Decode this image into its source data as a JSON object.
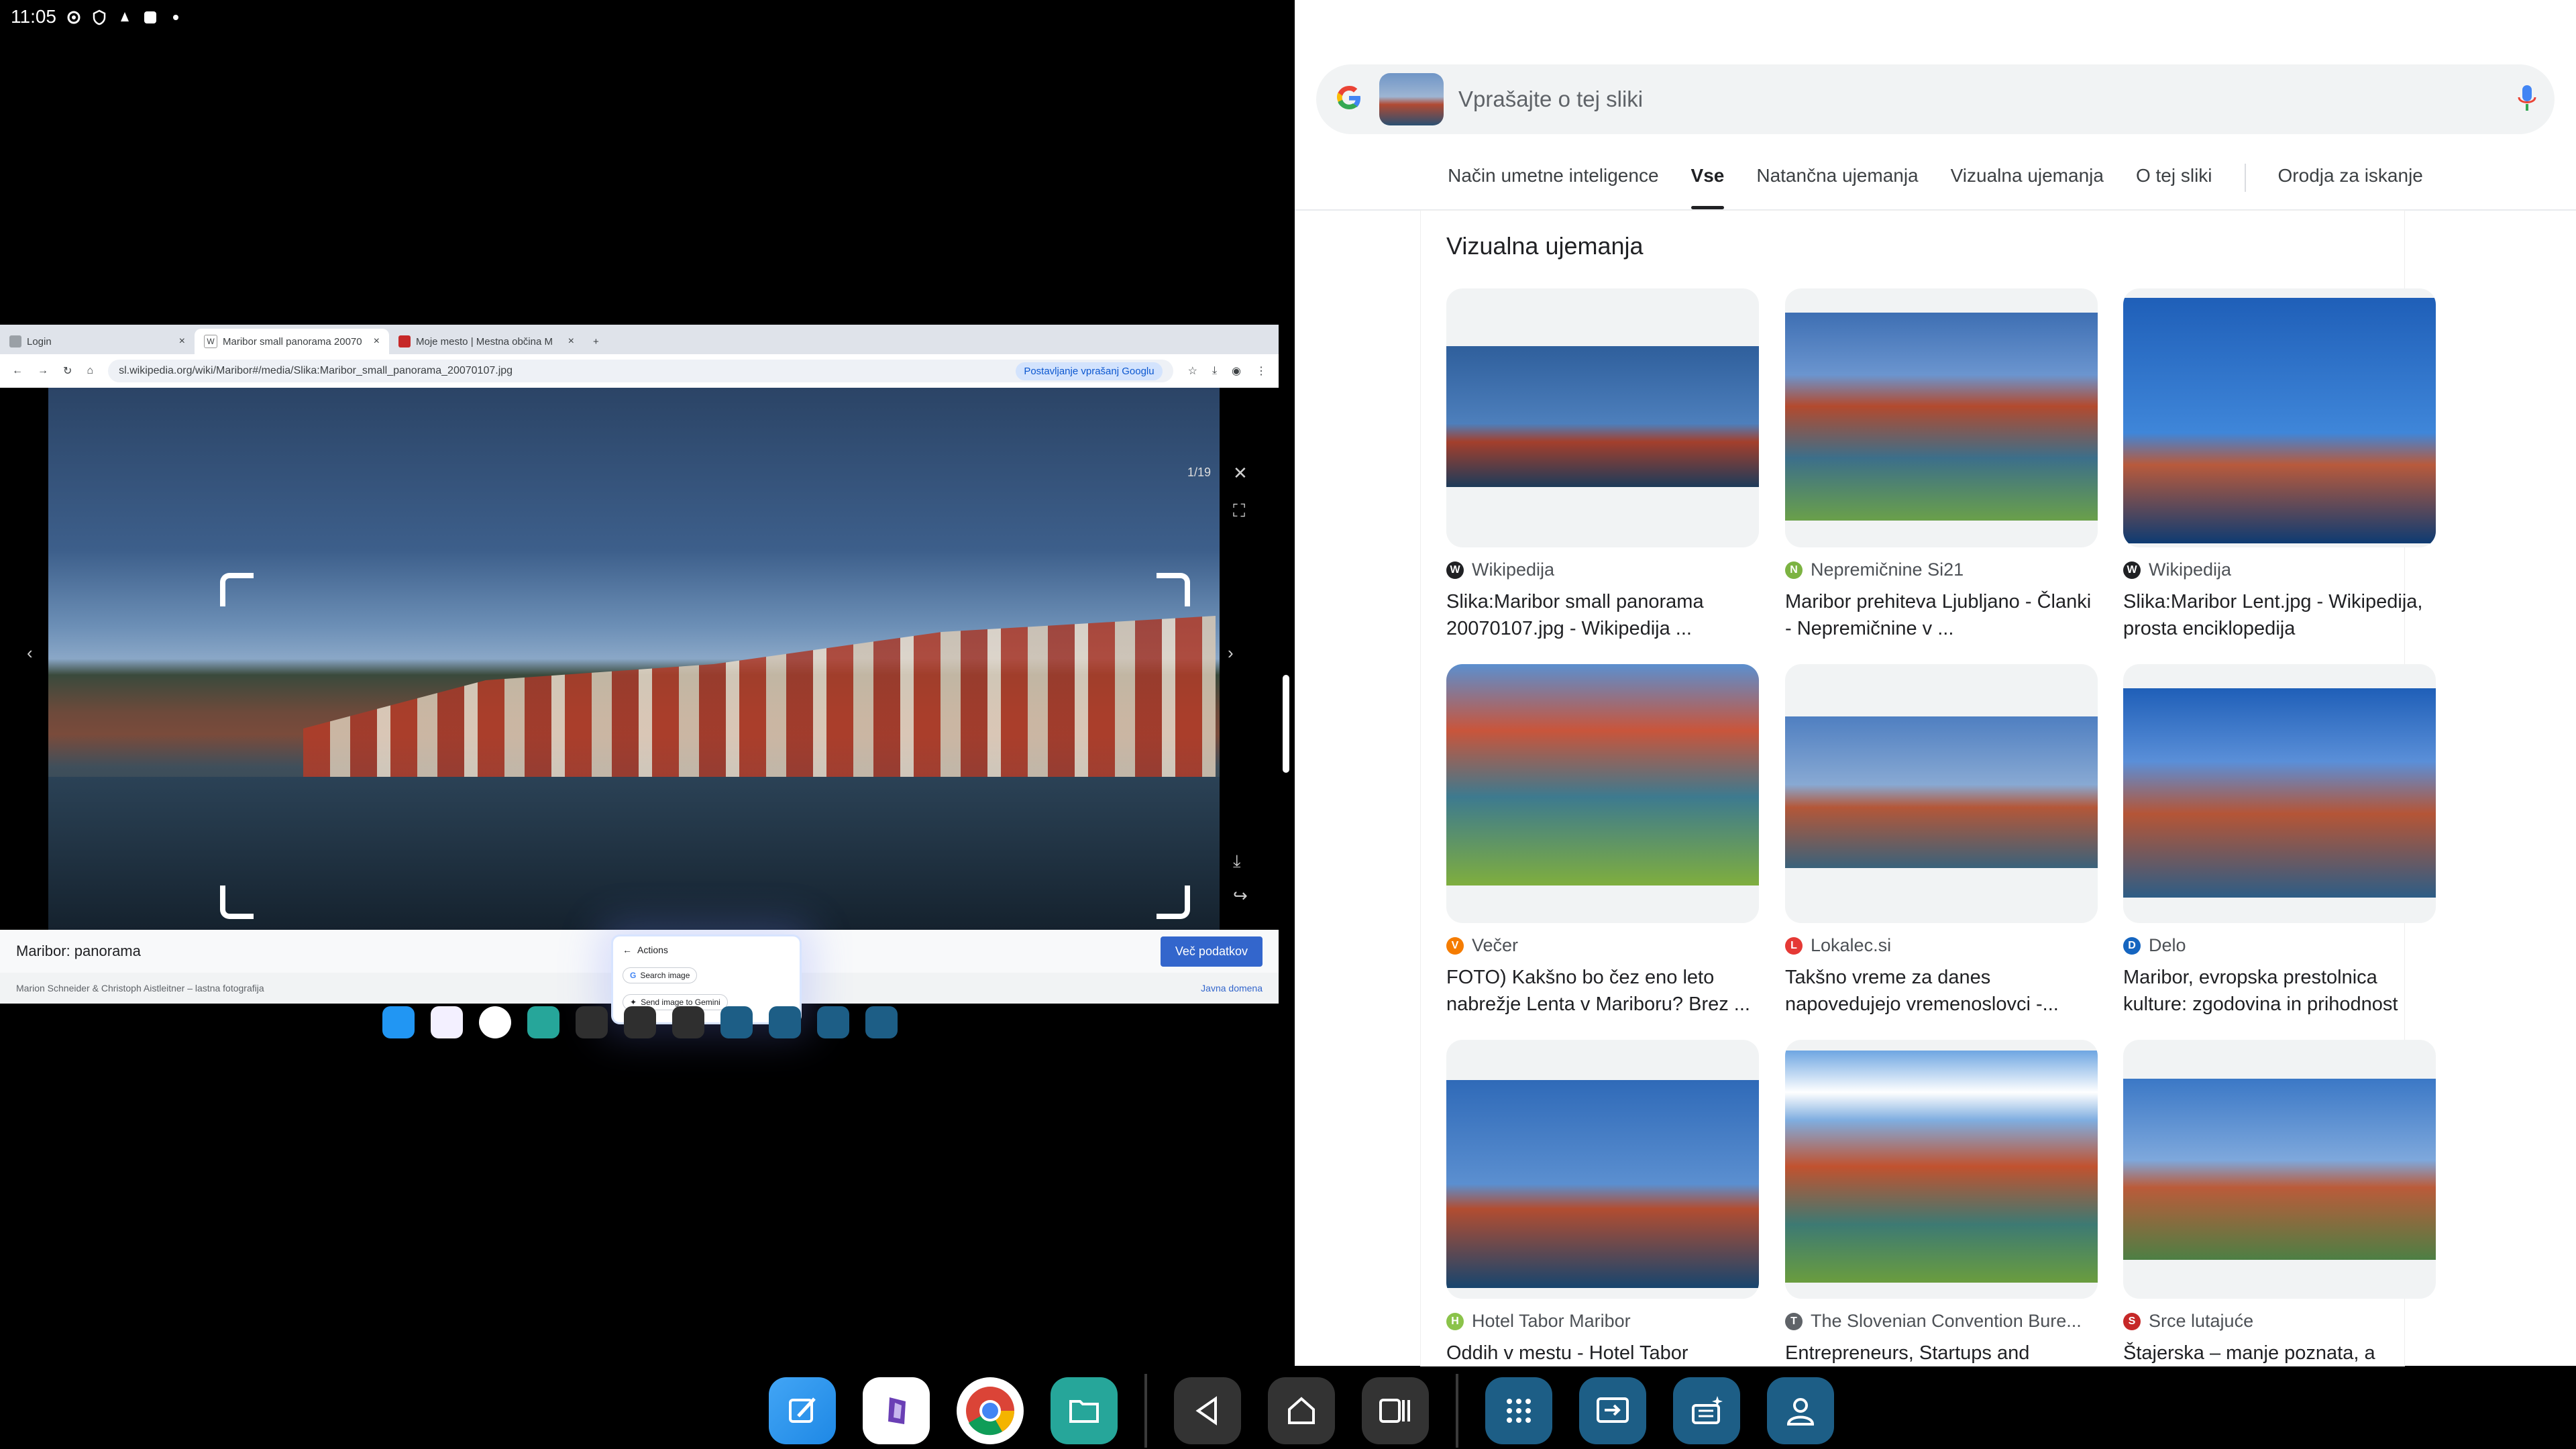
{
  "status_bar": {
    "time": "11:05",
    "icons": [
      "gear-icon",
      "shield-icon",
      "bell-icon",
      "square-icon",
      "dot-icon"
    ]
  },
  "left_browser": {
    "tabs": [
      {
        "label": "Login",
        "active": false
      },
      {
        "label": "Maribor small panorama 20070",
        "active": true
      },
      {
        "label": "Moje mesto | Mestna občina M",
        "active": false
      }
    ],
    "url": "sl.wikipedia.org/wiki/Maribor#/media/Slika:Maribor_small_panorama_20070107.jpg",
    "ask_google": "Postavljanje vprašanj Googlu",
    "image_counter": "1/19",
    "caption": "Maribor: panorama",
    "more_button": "Več podatkov",
    "credits": "Marion Schneider & Christoph Aistleitner – lastna fotografija",
    "license": "Javna domena",
    "actions_popup": {
      "title": "Actions",
      "search_image": "Search image",
      "send_to_gemini": "Send image to Gemini"
    }
  },
  "right_panel": {
    "search_placeholder": "Vprašajte o tej sliki",
    "tabs": [
      "Način umetne inteligence",
      "Vse",
      "Natančna ujemanja",
      "Vizualna ujemanja",
      "O tej sliki",
      "Orodja za iskanje"
    ],
    "selected_tab": "Vse",
    "section_title": "Vizualna ujemanja",
    "results": [
      {
        "source": "Wikipedija",
        "title": "Slika:Maribor small panorama 20070107.jpg - Wikipedija ...",
        "icon_color": "#202124"
      },
      {
        "source": "Nepremičnine Si21",
        "title": "Maribor prehiteva Ljubljano - Članki - Nepremičnine v ...",
        "icon_color": "#7cb342"
      },
      {
        "source": "Wikipedija",
        "title": "Slika:Maribor Lent.jpg - Wikipedija, prosta enciklopedija",
        "icon_color": "#202124"
      },
      {
        "source": "Večer",
        "title": "FOTO) Kakšno bo čez eno leto nabrežje Lenta v Mariboru? Brez ...",
        "icon_color": "#f57c00"
      },
      {
        "source": "Lokalec.si",
        "title": "Takšno vreme za danes napovedujejo vremenoslovci -...",
        "icon_color": "#e53935"
      },
      {
        "source": "Delo",
        "title": "Maribor, evropska prestolnica kulture: zgodovina in prihodnost",
        "icon_color": "#1565c0"
      },
      {
        "source": "Hotel Tabor Maribor",
        "title": "Oddih v mestu - Hotel Tabor",
        "icon_color": "#8bc34a"
      },
      {
        "source": "The Slovenian Convention Bure...",
        "title": "Entrepreneurs, Startups and",
        "icon_color": "#5f6368"
      },
      {
        "source": "Srce lutajuće",
        "title": "Štajerska – manje poznata, a",
        "icon_color": "#c62828"
      }
    ]
  },
  "dock": [
    "notes-icon",
    "obsidian-icon",
    "chrome-icon",
    "files-icon",
    "back-icon",
    "home-icon",
    "recents-icon",
    "apps-grid-icon",
    "cast-icon",
    "tray-icon",
    "account-icon"
  ]
}
